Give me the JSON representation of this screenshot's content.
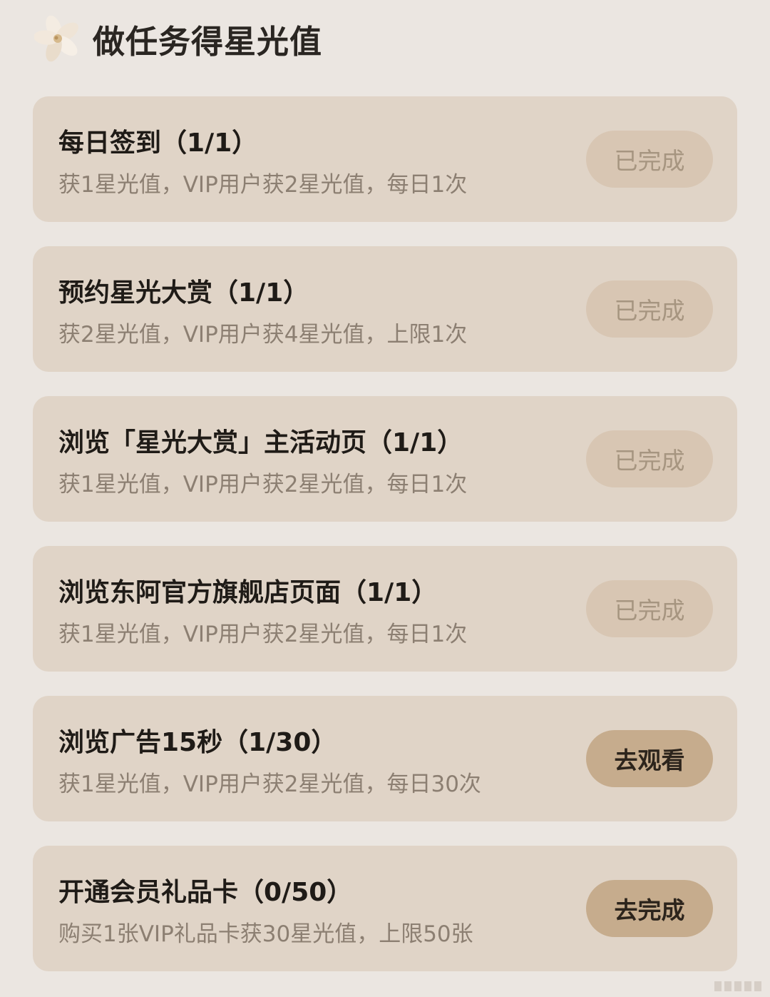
{
  "header": {
    "icon": "flower-icon",
    "title": "做任务得星光值"
  },
  "colors": {
    "background": "#ebe6e1",
    "card": "#e0d4c7",
    "button_done": "#d8c6b3",
    "button_active": "#c6ac8d"
  },
  "tasks": [
    {
      "title": "每日签到（1/1）",
      "desc": "获1星光值，VIP用户获2星光值，每日1次",
      "button": "已完成",
      "status": "done"
    },
    {
      "title": "预约星光大赏（1/1）",
      "desc": "获2星光值，VIP用户获4星光值，上限1次",
      "button": "已完成",
      "status": "done"
    },
    {
      "title": "浏览「星光大赏」主活动页（1/1）",
      "desc": "获1星光值，VIP用户获2星光值，每日1次",
      "button": "已完成",
      "status": "done"
    },
    {
      "title": "浏览东阿官方旗舰店页面（1/1）",
      "desc": "获1星光值，VIP用户获2星光值，每日1次",
      "button": "已完成",
      "status": "done"
    },
    {
      "title": "浏览广告15秒（1/30）",
      "desc": "获1星光值，VIP用户获2星光值，每日30次",
      "button": "去观看",
      "status": "active"
    },
    {
      "title": "开通会员礼品卡（0/50）",
      "desc": "购买1张VIP礼品卡获30星光值，上限50张",
      "button": "去完成",
      "status": "active"
    }
  ]
}
